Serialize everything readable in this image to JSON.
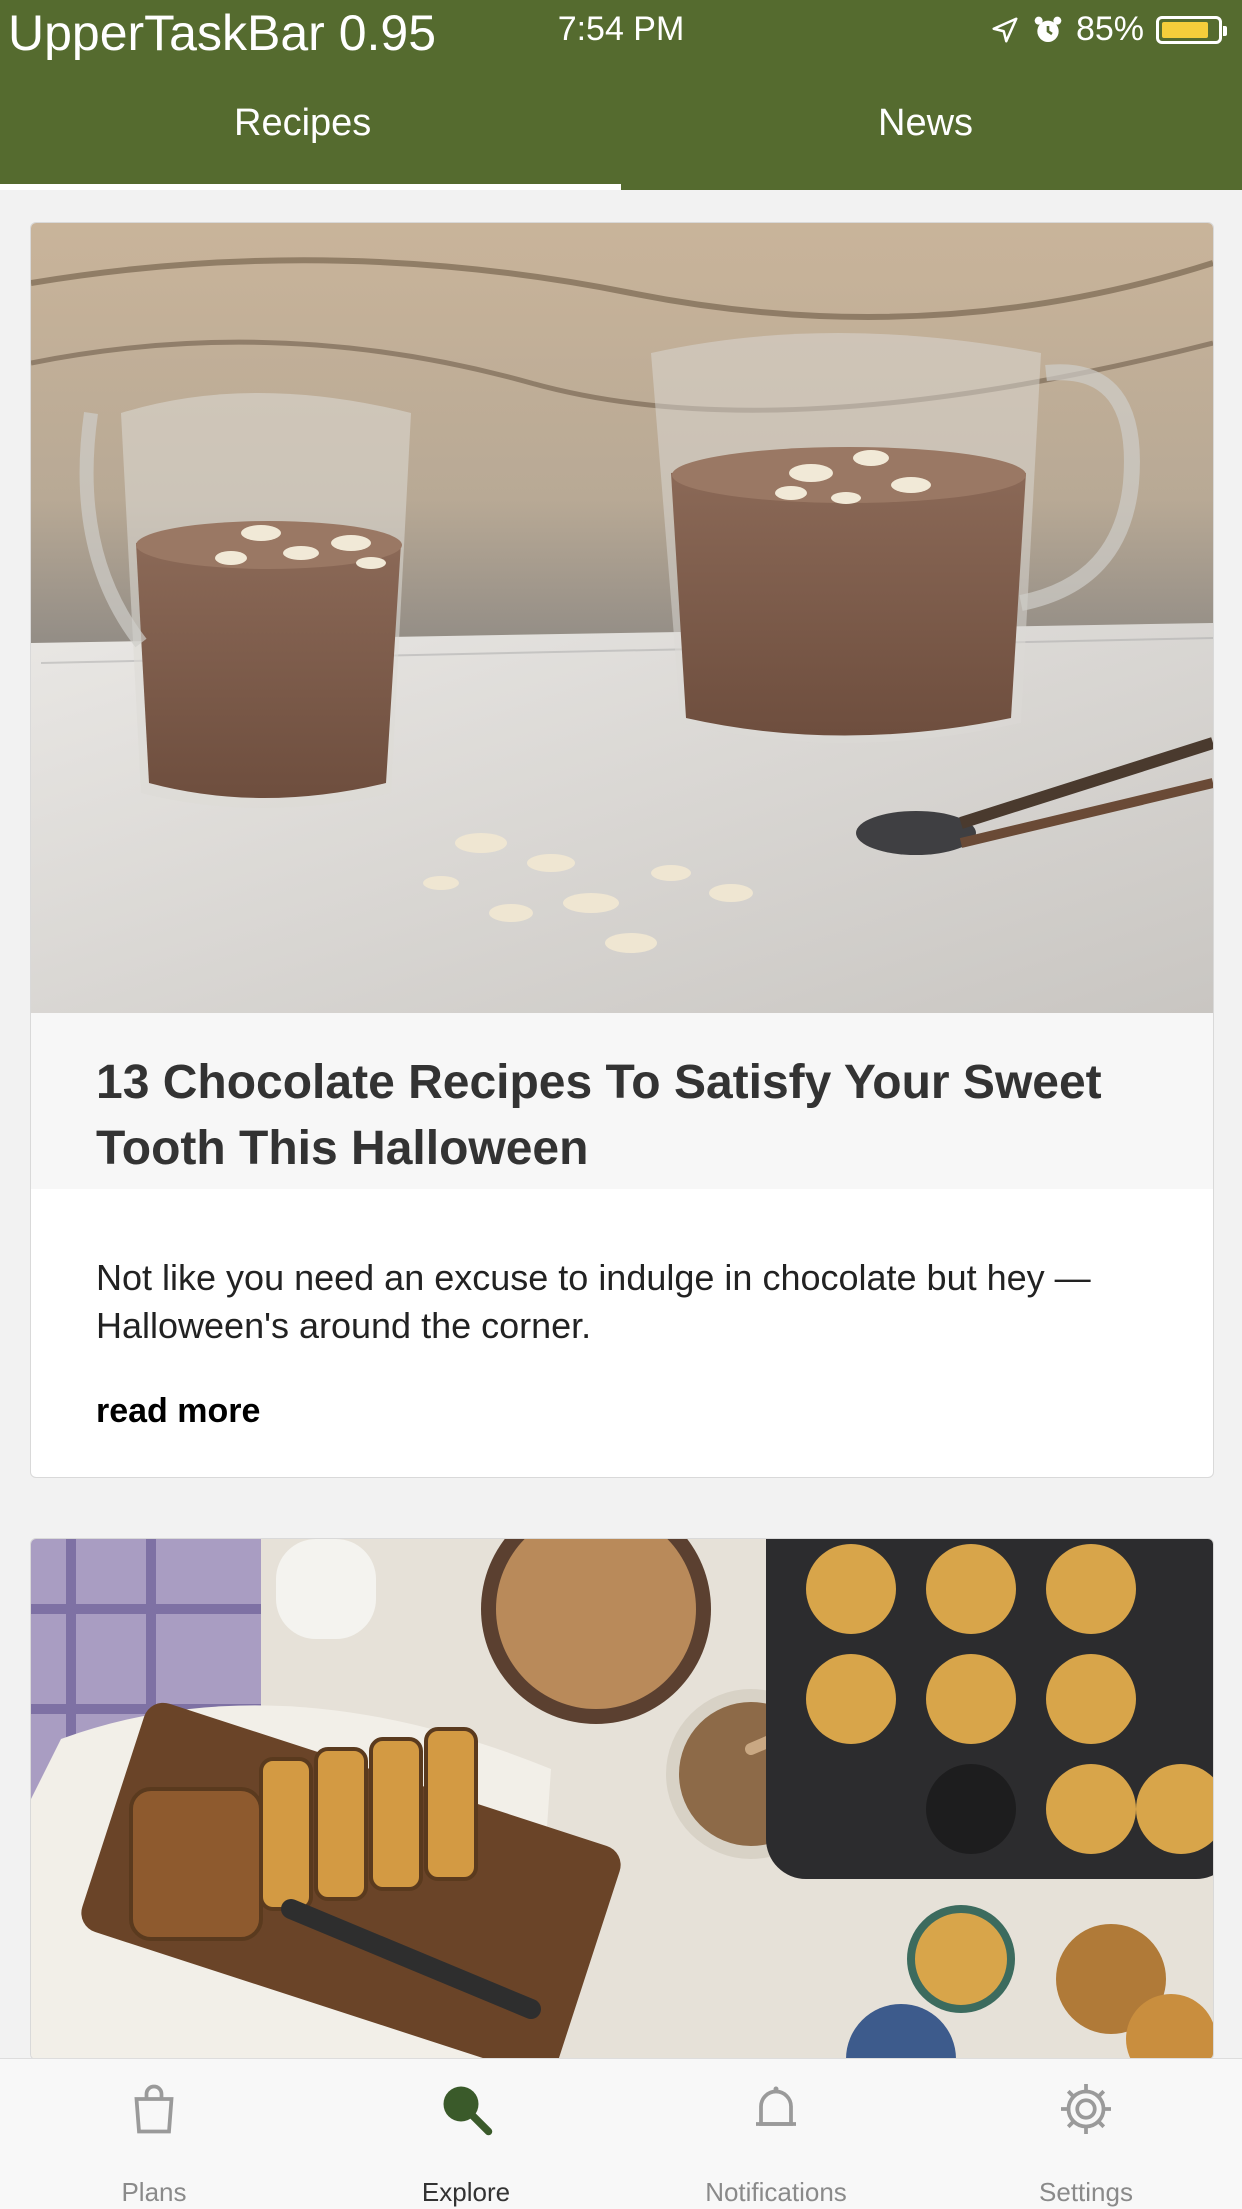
{
  "status_bar": {
    "app_label": "UpperTaskBar 0.95",
    "time": "7:54 PM",
    "battery": "85%",
    "battery_level": 0.85,
    "icons": [
      "location-arrow-icon",
      "alarm-clock-icon",
      "battery-icon"
    ]
  },
  "top_tabs": [
    {
      "label": "Recipes",
      "active": true
    },
    {
      "label": "News",
      "active": false
    }
  ],
  "articles": [
    {
      "image": "chocolate-pudding-cups-photo",
      "title": "13 Chocolate Recipes To Satisfy Your Sweet Tooth This Halloween",
      "excerpt": "Not like you need an excuse to indulge in chocolate but hey — Halloween's around the corner.",
      "read_more": "read more"
    },
    {
      "image": "granola-loaf-and-muffins-photo"
    }
  ],
  "bottom_tabs": [
    {
      "label": "Plans",
      "icon": "shopping-bag-icon"
    },
    {
      "label": "Explore",
      "icon": "search-icon",
      "active": true
    },
    {
      "label": "Notifications",
      "icon": "bell-icon"
    },
    {
      "label": "Settings",
      "icon": "gear-icon"
    }
  ],
  "colors": {
    "header": "#556b2f",
    "battery_fill": "#f5cd3b",
    "title_text": "#333333"
  }
}
